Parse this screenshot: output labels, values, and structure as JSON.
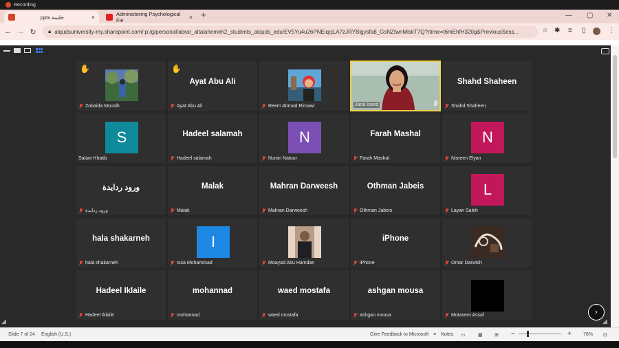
{
  "recording": {
    "label": "Recording"
  },
  "tabs": [
    {
      "label": "pptx.جلسة",
      "close": "×"
    },
    {
      "label": "Administering Psychological Fie",
      "close": "×"
    }
  ],
  "new_tab": "+",
  "window_controls": {
    "minimize": "—",
    "maximize": "▢",
    "close": "✕"
  },
  "address": {
    "url": "alqudsuniversity-my.sharepoint.com/:p:/g/personal/abrar_altalahemeh2_students_alquds_edu/EV5Yu4u26PNEiqcjLA7zJRYBlgysfa8_GsNZtwnMiskT7Q?rtime=t6mEhfH320g&PreviousSess..."
  },
  "participants": [
    {
      "name": "Zobaida Mouslh",
      "hand": true,
      "kind": "photo",
      "photo": "park"
    },
    {
      "name": "Ayat Abu Ali",
      "hand": true,
      "kind": "name",
      "display": "Ayat Abu Ali"
    },
    {
      "name": "Reem Ahmad Rimawi",
      "kind": "photo",
      "photo": "selfie"
    },
    {
      "name": "Jana Iseed",
      "kind": "video",
      "speaking": true
    },
    {
      "name": "Shahd Shaheen",
      "kind": "name",
      "display": "Shahd Shaheen"
    },
    {
      "name": "Salam Khatib",
      "kind": "avatar",
      "initial": "S",
      "color": "#0e8a9a",
      "nomic": true
    },
    {
      "name": "Hadeel salamah",
      "kind": "name",
      "display": "Hadeel salamah"
    },
    {
      "name": "Nuran Natour",
      "kind": "avatar",
      "initial": "N",
      "color": "#7b4fb3"
    },
    {
      "name": "Farah Mashal",
      "kind": "name",
      "display": "Farah Mashal"
    },
    {
      "name": "Nisreen Elyan",
      "kind": "avatar",
      "initial": "N",
      "color": "#c2185b"
    },
    {
      "name": "ورود ردايدة",
      "kind": "name",
      "display": "ورود ردايدة"
    },
    {
      "name": "Malak",
      "kind": "name",
      "display": "Malak"
    },
    {
      "name": "Mahran Darweesh",
      "kind": "name",
      "display": "Mahran Darweesh"
    },
    {
      "name": "Othman Jabeis",
      "kind": "name",
      "display": "Othman Jabeis"
    },
    {
      "name": "Layan Saleh",
      "kind": "avatar",
      "initial": "L",
      "color": "#c2185b"
    },
    {
      "name": "hala shakarneh",
      "kind": "name",
      "display": "hala shakarneh"
    },
    {
      "name": "Issa Mohammad",
      "kind": "avatar",
      "initial": "I",
      "color": "#1e88e5"
    },
    {
      "name": "Moayad Abu Hamdan",
      "kind": "photo",
      "photo": "man"
    },
    {
      "name": "iPhone",
      "kind": "name",
      "display": "iPhone"
    },
    {
      "name": "Omar Darwish",
      "kind": "photo",
      "photo": "art"
    },
    {
      "name": "Hadeel Iklaile",
      "kind": "name",
      "display": "Hadeel Iklaile"
    },
    {
      "name": "mohannad",
      "kind": "name",
      "display": "mohannad"
    },
    {
      "name": "waed mostafa",
      "kind": "name",
      "display": "waed mostafa"
    },
    {
      "name": "ashgan mousa",
      "kind": "name",
      "display": "ashgan mousa"
    },
    {
      "name": "Motasem Assaf",
      "kind": "black"
    }
  ],
  "next_button": "›",
  "status": {
    "slide": "Slide 7 of 24",
    "language": "English (U.S.)",
    "feedback": "Give Feedback to Microsoft",
    "notes": "Notes",
    "zoom": "76%",
    "zoom_minus": "−",
    "zoom_plus": "+"
  },
  "colors": {
    "accent": "#f1d04a",
    "tab_bg": "#f0d6d2",
    "meeting_bg": "#292929"
  }
}
